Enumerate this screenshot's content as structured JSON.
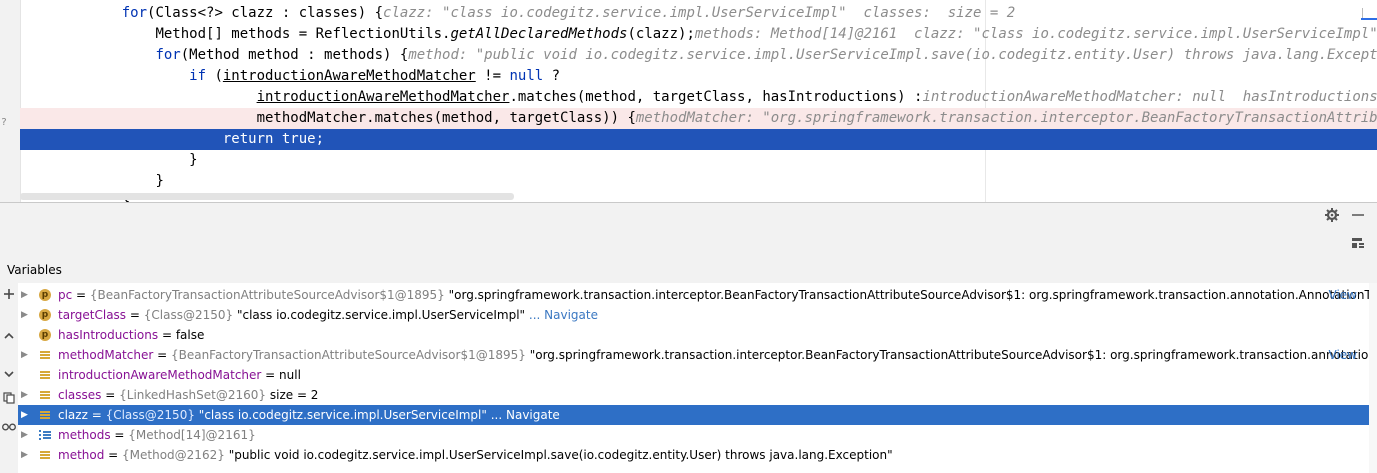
{
  "editor": {
    "lines": [
      {
        "indent": "    ",
        "parts": [
          [
            "kw",
            "for"
          ],
          [
            "",
            "("
          ],
          [
            "",
            "Class<?> clazz : classes) {"
          ]
        ],
        "hint": "clazz: \"class io.codegitz.service.impl.UserServiceImpl\"  classes:  size = 2"
      },
      {
        "indent": "        ",
        "parts": [
          [
            "",
            "Method[] methods = ReflectionUtils."
          ],
          [
            "ital",
            "getAllDeclaredMethods"
          ],
          [
            "",
            "(clazz);"
          ]
        ],
        "hint": "methods: Method[14]@2161  clazz: \"class io.codegitz.service.impl.UserServiceImpl\""
      },
      {
        "indent": "        ",
        "parts": [
          [
            "kw",
            "for"
          ],
          [
            "",
            "(Method method : methods) {"
          ]
        ],
        "hint": "method: \"public void io.codegitz.service.impl.UserServiceImpl.save(io.codegitz.entity.User) throws java.lang.Exception\"  me"
      },
      {
        "indent": "            ",
        "parts": [
          [
            "kw",
            "if"
          ],
          [
            "",
            " ("
          ],
          [
            "ul",
            "introductionAwareMethodMatcher"
          ],
          [
            "",
            " != "
          ],
          [
            "kw",
            "null"
          ],
          [
            "",
            " ?"
          ]
        ],
        "hint": ""
      },
      {
        "indent": "                    ",
        "parts": [
          [
            "ul",
            "introductionAwareMethodMatcher"
          ],
          [
            "",
            ".matches(method, targetClass, hasIntroductions) :"
          ]
        ],
        "hint": "introductionAwareMethodMatcher: null  hasIntroductions: false"
      },
      {
        "indent": "                    ",
        "parts": [
          [
            "",
            "methodMatcher.matches(method, targetClass)) {"
          ]
        ],
        "hint": "methodMatcher: \"org.springframework.transaction.interceptor.BeanFactoryTransactionAttributeSource."
      },
      {
        "indent": "                ",
        "parts": [
          [
            "kw",
            "return"
          ],
          [
            "",
            " "
          ],
          [
            "kw",
            "true"
          ],
          [
            "",
            ";"
          ]
        ],
        "hint": ""
      },
      {
        "indent": "            ",
        "parts": [
          [
            "",
            "}"
          ]
        ],
        "hint": ""
      },
      {
        "indent": "        ",
        "parts": [
          [
            "",
            "}"
          ]
        ],
        "hint": ""
      },
      {
        "indent": "    ",
        "parts": [
          [
            "",
            "}"
          ]
        ],
        "hint": ""
      }
    ]
  },
  "panel": {
    "title": "Variables",
    "settings_icon": "gear-icon",
    "minimize_icon": "minimize-icon",
    "layout_icon": "layout-icon"
  },
  "left_toolbar": [
    "plus-icon",
    "up-arrow-icon",
    "down-arrow-icon",
    "copy-icon",
    "glasses-icon"
  ],
  "variables": [
    {
      "expandable": true,
      "icon": "p",
      "name": "pc",
      "type": "{BeanFactoryTransactionAttributeSourceAdvisor$1@1895}",
      "value": "\"org.springframework.transaction.interceptor.BeanFactoryTransactionAttributeSourceAdvisor$1: org.springframework.transaction.annotation.AnnotationTra...",
      "link": "View",
      "selected": false
    },
    {
      "expandable": true,
      "icon": "p",
      "name": "targetClass",
      "type": "{Class@2150}",
      "value": "\"class io.codegitz.service.impl.UserServiceImpl\"",
      "link": "... Navigate",
      "selected": false
    },
    {
      "expandable": false,
      "icon": "p",
      "name": "hasIntroductions",
      "type": "",
      "value": "false",
      "link": "",
      "selected": false
    },
    {
      "expandable": true,
      "icon": "field",
      "name": "methodMatcher",
      "type": "{BeanFactoryTransactionAttributeSourceAdvisor$1@1895}",
      "value": "\"org.springframework.transaction.interceptor.BeanFactoryTransactionAttributeSourceAdvisor$1: org.springframework.transaction.annotation.A...",
      "link": "View",
      "selected": false
    },
    {
      "expandable": false,
      "icon": "field",
      "name": "introductionAwareMethodMatcher",
      "type": "",
      "value": "null",
      "link": "",
      "selected": false
    },
    {
      "expandable": true,
      "icon": "field",
      "name": "classes",
      "type": "{LinkedHashSet@2160}",
      "value": " size = 2",
      "link": "",
      "selected": false
    },
    {
      "expandable": true,
      "icon": "field",
      "name": "clazz",
      "type": "{Class@2150}",
      "value": "\"class io.codegitz.service.impl.UserServiceImpl\"",
      "link": "... Navigate",
      "selected": true
    },
    {
      "expandable": true,
      "icon": "arr",
      "name": "methods",
      "type": "{Method[14]@2161}",
      "value": "",
      "link": "",
      "selected": false
    },
    {
      "expandable": true,
      "icon": "field",
      "name": "method",
      "type": "{Method@2162}",
      "value": "\"public void io.codegitz.service.impl.UserServiceImpl.save(io.codegitz.entity.User) throws java.lang.Exception\"",
      "link": "",
      "selected": false
    }
  ]
}
